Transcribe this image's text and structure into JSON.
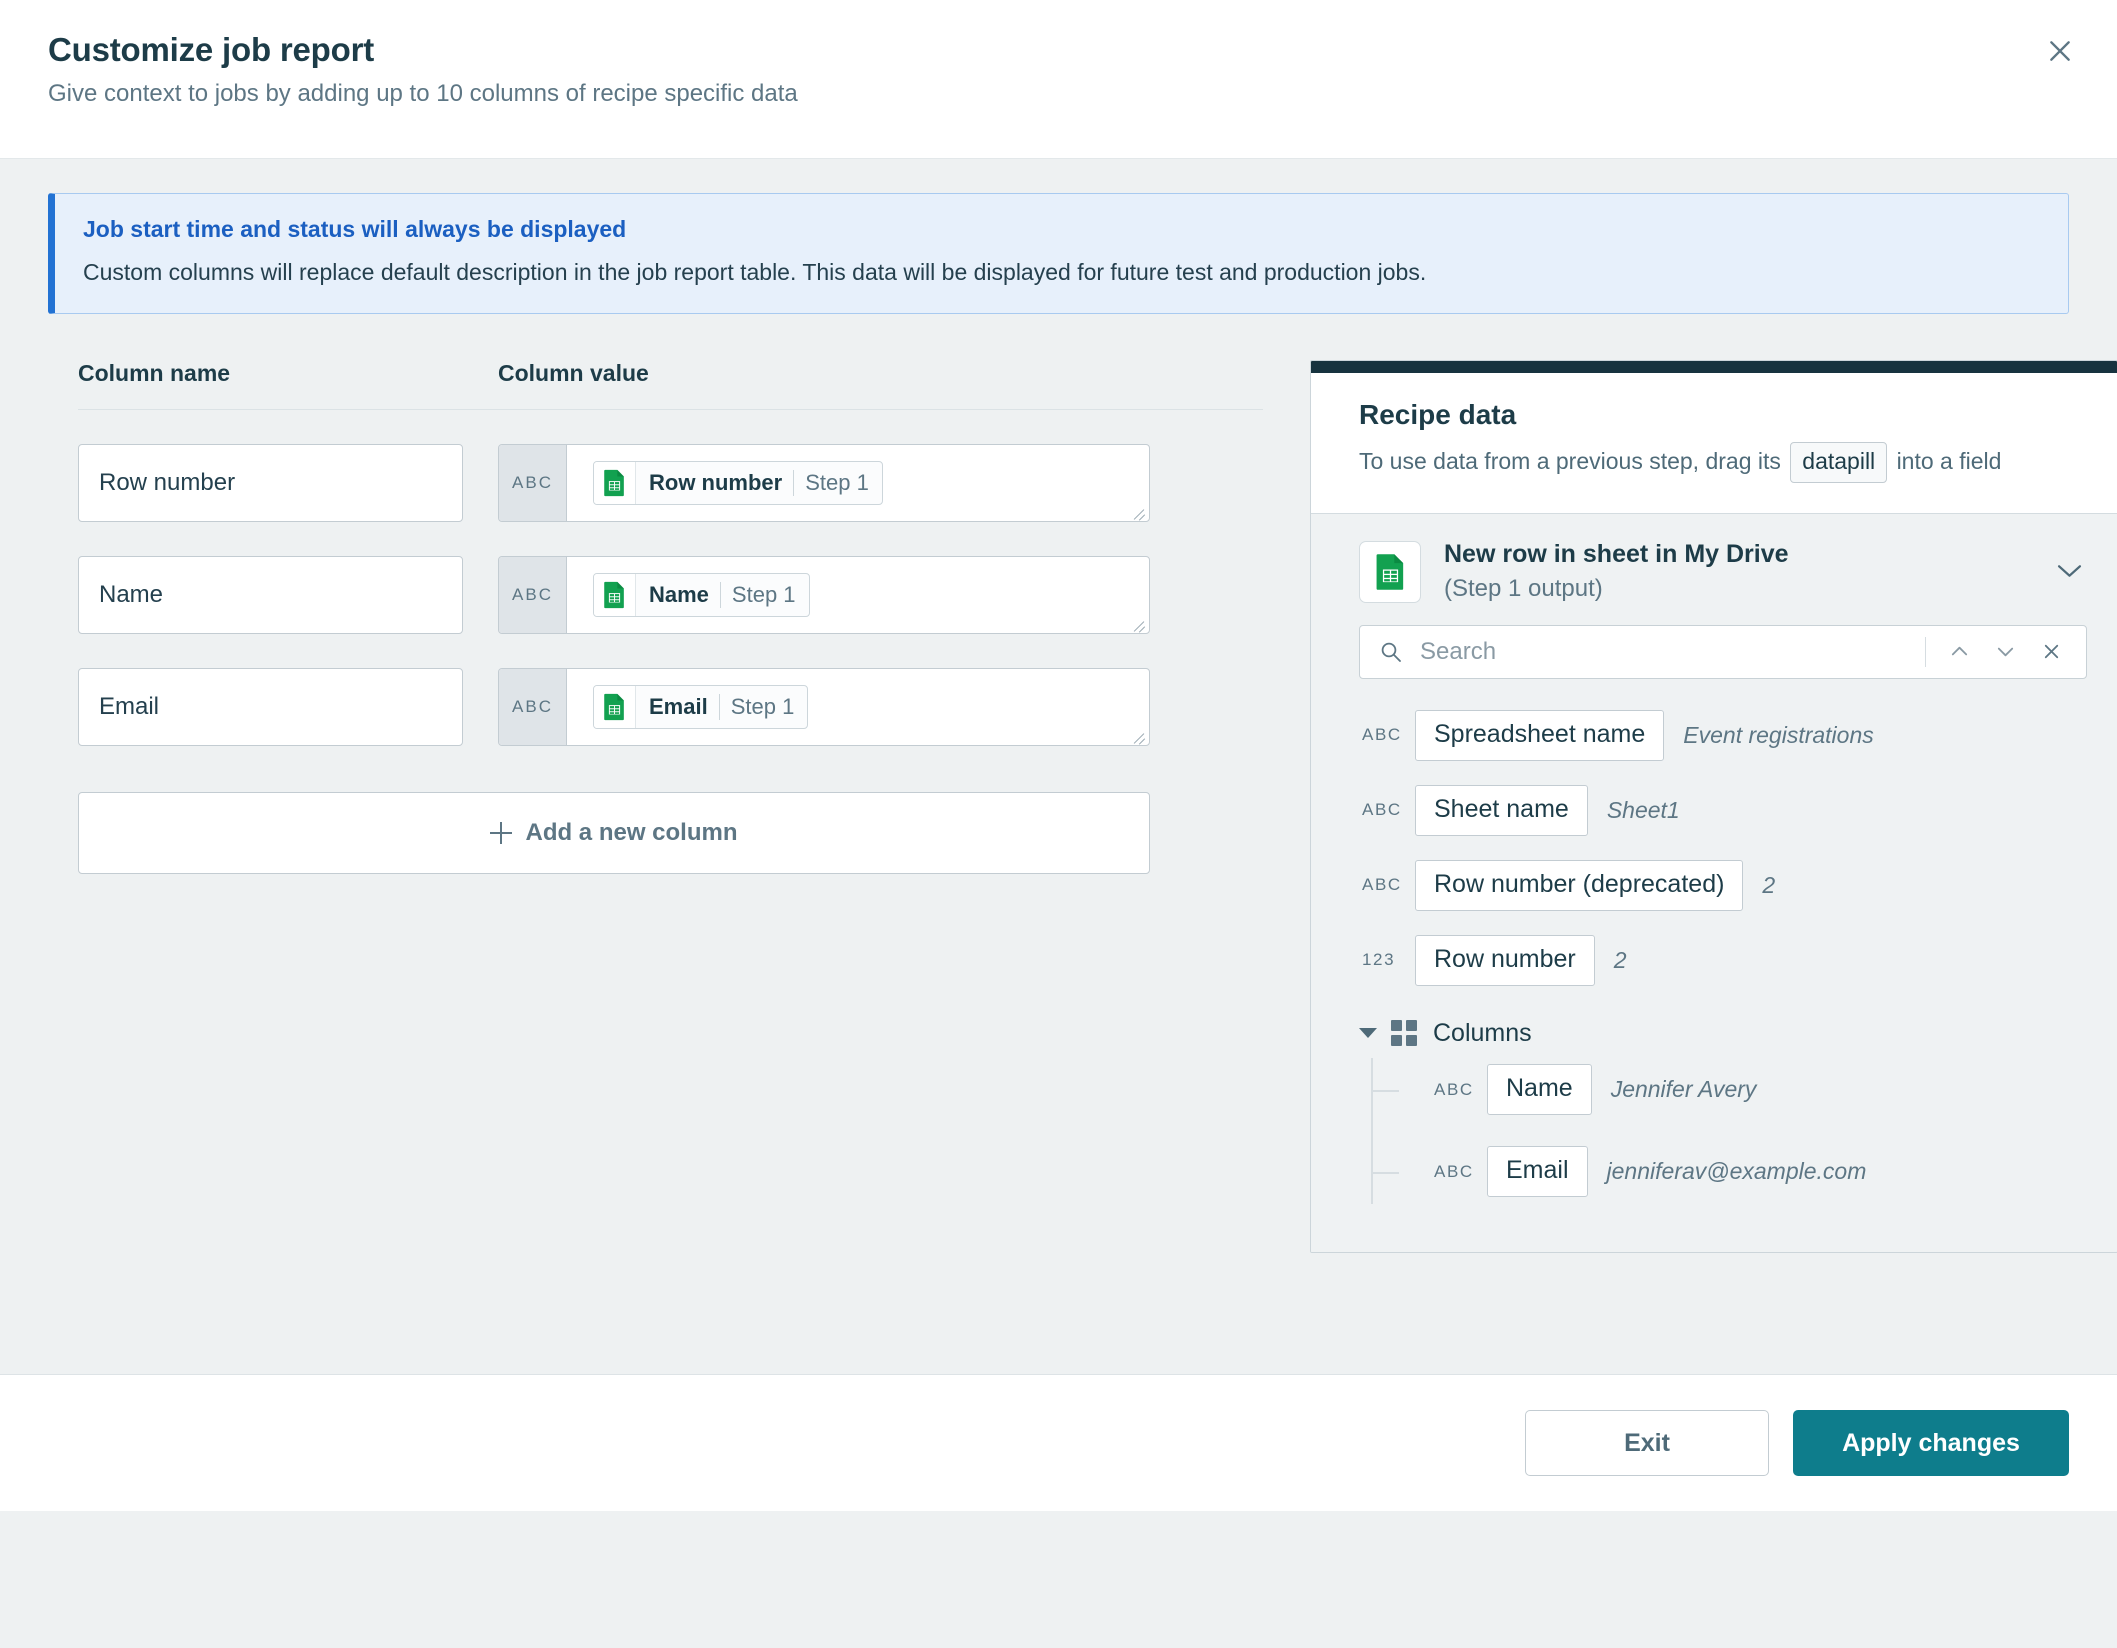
{
  "header": {
    "title": "Customize job report",
    "subtitle": "Give context to jobs by adding up to 10 columns of recipe specific data",
    "close_icon": "close-icon"
  },
  "banner": {
    "title": "Job start time and status will always be displayed",
    "text": "Custom columns will replace default description in the job report table. This data will be displayed for future test and production jobs.",
    "accent_color": "#2272d3",
    "background_color": "#e7f0fb"
  },
  "columns_table": {
    "head_name": "Column name",
    "head_value": "Column value",
    "rows": [
      {
        "name": "Row number",
        "type_badge": "ABC",
        "pill_label": "Row number",
        "pill_step": "Step 1",
        "pill_icon": "google-sheets-icon"
      },
      {
        "name": "Name",
        "type_badge": "ABC",
        "pill_label": "Name",
        "pill_step": "Step 1",
        "pill_icon": "google-sheets-icon"
      },
      {
        "name": "Email",
        "type_badge": "ABC",
        "pill_label": "Email",
        "pill_step": "Step 1",
        "pill_icon": "google-sheets-icon"
      }
    ],
    "add_button": "Add a new column"
  },
  "recipe_panel": {
    "title": "Recipe data",
    "desc_before": "To use data from a previous step, drag its",
    "desc_pill": "datapill",
    "desc_after": "into a field",
    "step": {
      "title": "New row in sheet in My Drive",
      "subtitle": "(Step 1 output)",
      "app_icon": "google-sheets-icon",
      "chevron": "chevron-down-icon"
    },
    "search": {
      "placeholder": "Search",
      "value": "",
      "icon": "search-icon",
      "prev_icon": "chevron-up-icon",
      "next_icon": "chevron-down-icon",
      "clear_icon": "close-icon"
    },
    "fields": [
      {
        "type": "ABC",
        "label": "Spreadsheet name",
        "sample": "Event registrations"
      },
      {
        "type": "ABC",
        "label": "Sheet name",
        "sample": "Sheet1"
      },
      {
        "type": "ABC",
        "label": "Row number (deprecated)",
        "sample": "2"
      },
      {
        "type": "123",
        "label": "Row number",
        "sample": "2"
      }
    ],
    "group": {
      "label": "Columns",
      "expanded": true,
      "icon": "grid-icon",
      "toggle_icon": "triangle-down-icon",
      "children": [
        {
          "type": "ABC",
          "label": "Name",
          "sample": "Jennifer Avery"
        },
        {
          "type": "ABC",
          "label": "Email",
          "sample": "jenniferav@example.com"
        }
      ]
    }
  },
  "footer": {
    "exit_label": "Exit",
    "apply_label": "Apply changes",
    "primary_color": "#0e7d8c"
  }
}
